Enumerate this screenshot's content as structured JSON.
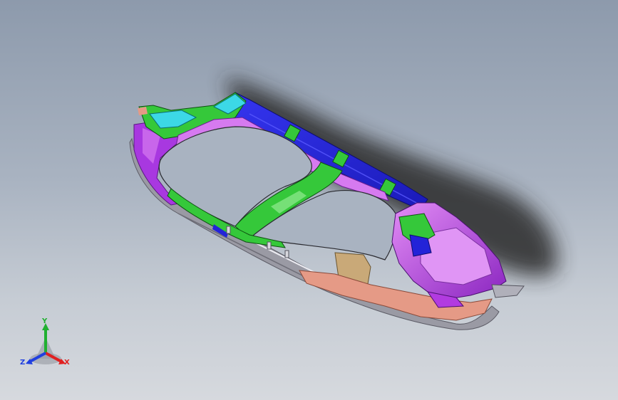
{
  "viewport": {
    "background_top": "#8d9aac",
    "background_bottom": "#d6d9de"
  },
  "model": {
    "colors": {
      "blue_rail": "#2323d8",
      "magenta": "#b23be0",
      "light_magenta": "#d67af0",
      "green": "#35c83a",
      "cyan": "#3cd8e6",
      "salmon": "#e59a86",
      "tan": "#c9a978",
      "grey_edge": "#8c8c96",
      "shadow": "#2a2a2a"
    }
  },
  "triad": {
    "x_label": "X",
    "y_label": "Y",
    "z_label": "Z",
    "x_color": "#e02020",
    "y_color": "#20b030",
    "z_color": "#2040e0"
  }
}
